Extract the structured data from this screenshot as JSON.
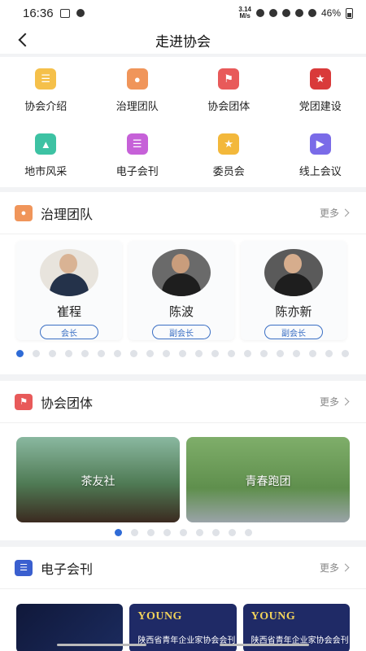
{
  "status": {
    "time": "16:36",
    "speed_top": "3.14",
    "speed_bottom": "M/s",
    "battery": "46%"
  },
  "nav": {
    "title": "走进协会"
  },
  "menu": [
    {
      "label": "协会介绍",
      "icon": "document-icon",
      "color": "#f5c04a"
    },
    {
      "label": "治理团队",
      "icon": "person-icon",
      "color": "#f0955a"
    },
    {
      "label": "协会团体",
      "icon": "flag-icon",
      "color": "#e85a5a"
    },
    {
      "label": "党团建设",
      "icon": "party-emblem-icon",
      "color": "#d93a3a"
    },
    {
      "label": "地市风采",
      "icon": "image-icon",
      "color": "#3dc2a3"
    },
    {
      "label": "电子会刊",
      "icon": "magazine-icon",
      "color": "#c661d8"
    },
    {
      "label": "委员会",
      "icon": "medal-icon",
      "color": "#f3b83b"
    },
    {
      "label": "线上会议",
      "icon": "video-icon",
      "color": "#7a6be8"
    }
  ],
  "team": {
    "title": "治理团队",
    "more": "更多",
    "members": [
      {
        "name": "崔程",
        "role": "会长"
      },
      {
        "name": "陈波",
        "role": "副会长"
      },
      {
        "name": "陈亦新",
        "role": "副会长"
      }
    ]
  },
  "groups": {
    "title": "协会团体",
    "more": "更多",
    "items": [
      {
        "label": "茶友社"
      },
      {
        "label": "青春跑团"
      }
    ]
  },
  "journal": {
    "title": "电子会刊",
    "more": "更多",
    "items": [
      {
        "title": "",
        "sub": ""
      },
      {
        "title": "YOUNG",
        "sub": "陕西省青年企业家协会会刊"
      },
      {
        "title": "YOUNG",
        "sub": "陕西省青年企业家协会会刊"
      }
    ]
  },
  "colors": {
    "accent": "#2f6bd6",
    "role_border": "#3a6fc4"
  }
}
